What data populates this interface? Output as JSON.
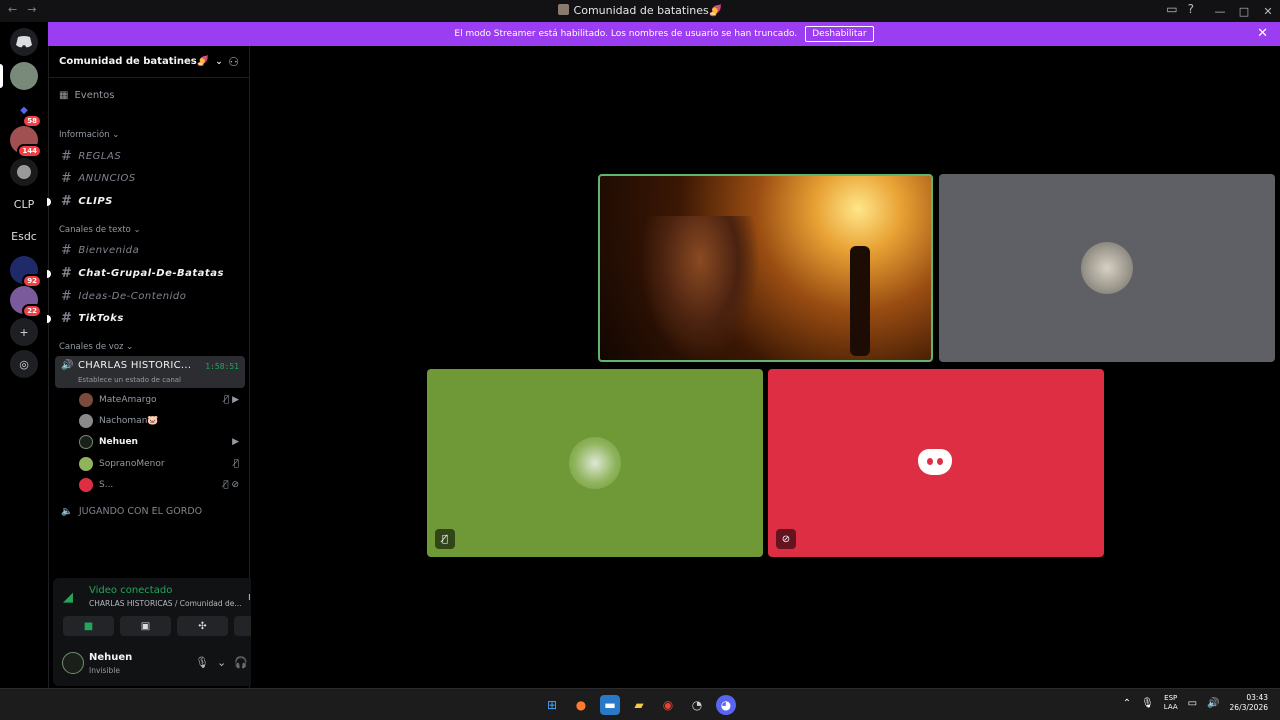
{
  "window": {
    "title": "Comunidad de batatines🍠",
    "nav_back": "←",
    "nav_forward": "→"
  },
  "banner": {
    "text": "El modo Streamer está habilitado. Los nombres de usuario se han truncado.",
    "button": "Deshabilitar",
    "close": "✕"
  },
  "guilds": [
    {
      "label": "",
      "badge": ""
    },
    {
      "label": "",
      "badge": "58"
    },
    {
      "label": "",
      "badge": "144"
    },
    {
      "label": "",
      "badge": ""
    },
    {
      "label": "CLP",
      "badge": ""
    },
    {
      "label": "Esdc",
      "badge": ""
    },
    {
      "label": "",
      "badge": "92"
    },
    {
      "label": "",
      "badge": "22"
    }
  ],
  "sidebar": {
    "server_name": "Comunidad de batatines🍠",
    "events": "Eventos",
    "categories": {
      "info": "Información",
      "text": "Canales de texto",
      "voice": "Canales de voz"
    },
    "info_channels": [
      {
        "name": "REGLAS",
        "unread": false
      },
      {
        "name": "ANUNCIOS",
        "unread": false
      },
      {
        "name": "CLIPS",
        "unread": true
      }
    ],
    "text_channels": [
      {
        "name": "Bienvenida",
        "unread": false
      },
      {
        "name": "Chat-Grupal-De-Batatas",
        "unread": true
      },
      {
        "name": "Ideas-De-Contenido",
        "unread": false
      },
      {
        "name": "TikToks",
        "unread": true
      }
    ],
    "active_voice": {
      "name": "CHARLAS HISTORIC...",
      "timer": "1:58:51",
      "status": "Establece un estado de canal"
    },
    "voice_users": [
      {
        "name": "MateAmargo",
        "color": "#7a4a3a",
        "icons": "🎙̸ ▶"
      },
      {
        "name": "Nachoman🐷",
        "color": "#8a8a8a",
        "icons": ""
      },
      {
        "name": "Nehuen",
        "color": "#1a1f1a",
        "icons": "▶"
      },
      {
        "name": "SopranoMenor",
        "color": "#8fb45d",
        "icons": "🎙̸"
      },
      {
        "name": "S...",
        "color": "#dd2e44",
        "icons": "🎙̸ ⊘"
      }
    ],
    "other_voice": "JUGANDO CON EL GORDO"
  },
  "rtc": {
    "status": "Video conectado",
    "channel": "CHARLAS HISTORICAS / Comunidad de..."
  },
  "user": {
    "name": "Nehuen",
    "status": "Invisible"
  },
  "taskbar": {
    "lang_top": "ESP",
    "lang_bottom": "LAA",
    "time": "03:43",
    "date": "26/3/2026"
  },
  "colors": {
    "accent_green": "#23a55a",
    "banner_purple": "#9b3df0",
    "tile_green": "#6f9936",
    "tile_red": "#dd2e44",
    "tile_gray": "#5f6066"
  }
}
